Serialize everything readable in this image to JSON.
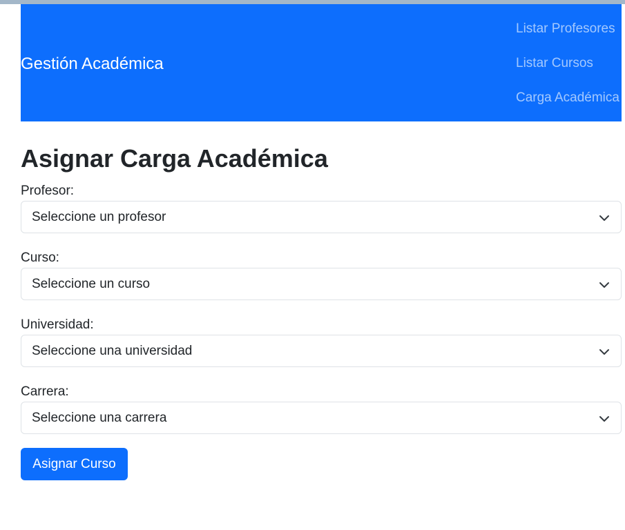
{
  "navbar": {
    "brand": "Gestión Académica",
    "links": [
      {
        "label": "Listar Profesores"
      },
      {
        "label": "Listar Cursos"
      },
      {
        "label": "Carga Académica"
      }
    ]
  },
  "page": {
    "title": "Asignar Carga Académica"
  },
  "form": {
    "fields": [
      {
        "label": "Profesor:",
        "selected": "Seleccione un profesor"
      },
      {
        "label": "Curso:",
        "selected": "Seleccione un curso"
      },
      {
        "label": "Universidad:",
        "selected": "Seleccione una universidad"
      },
      {
        "label": "Carrera:",
        "selected": "Seleccione una carrera"
      }
    ],
    "submit_label": "Asignar Curso"
  },
  "colors": {
    "primary": "#0d6efd",
    "border": "#dee2e6",
    "text": "#212529"
  },
  "icons": {
    "select_arrow": "chevron-down-icon"
  }
}
